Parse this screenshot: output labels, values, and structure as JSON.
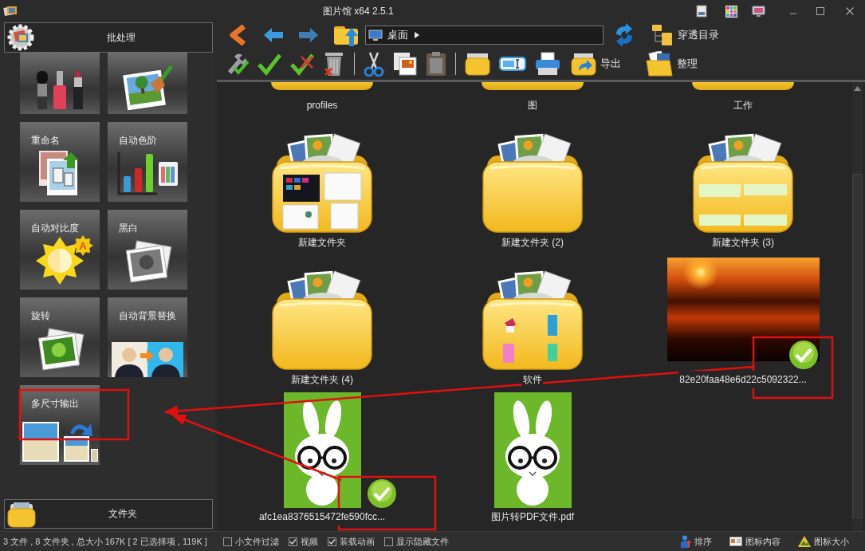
{
  "window": {
    "title": "图片馆 x64 2.5.1"
  },
  "sidebar": {
    "batch_button": "批处理",
    "tools": [
      {
        "kind": "beauty",
        "clipped": true
      },
      {
        "kind": "optimize",
        "clipped": true
      },
      {
        "kind": "rename",
        "label": "重命名",
        "clipped": false
      },
      {
        "kind": "levels",
        "label": "自动色阶",
        "clipped": false
      },
      {
        "kind": "contrast",
        "label": "自动对比度",
        "badge": "A",
        "clipped": false
      },
      {
        "kind": "bw",
        "label": "黑白",
        "clipped": false
      },
      {
        "kind": "rotate",
        "label": "旋转",
        "clipped": false
      },
      {
        "kind": "background",
        "label": "自动背景替换",
        "clipped": false
      },
      {
        "kind": "multisize",
        "label": "多尺寸输出",
        "clipped": false
      }
    ],
    "folder_button": "文件夹"
  },
  "toolbar": {
    "address": "桌面",
    "tree_button": "穿透目录",
    "export_button": "导出",
    "organize_button": "整理"
  },
  "files": [
    {
      "kind": "folder",
      "name": "profiles",
      "clipped": true,
      "selected": false
    },
    {
      "kind": "folder",
      "name": "图",
      "clipped": true,
      "selected": false
    },
    {
      "kind": "folder",
      "name": "工作",
      "clipped": true,
      "selected": false
    },
    {
      "kind": "folder",
      "name": "新建文件夹",
      "preview": {
        "kind": "screens"
      },
      "clipped": false,
      "selected": false
    },
    {
      "kind": "folder",
      "name": "新建文件夹 (2)",
      "clipped": false,
      "selected": false
    },
    {
      "kind": "folder",
      "name": "新建文件夹 (3)",
      "preview": {
        "kind": "tickets"
      },
      "clipped": false,
      "selected": false
    },
    {
      "kind": "folder",
      "name": "新建文件夹 (4)",
      "clipped": false,
      "selected": false
    },
    {
      "kind": "folder",
      "name": "软件",
      "preview": {
        "kind": "apps"
      },
      "clipped": false,
      "selected": false
    },
    {
      "kind": "photo",
      "name": "82e20faa48e6d22c5092322...",
      "clipped": false,
      "selected": true
    },
    {
      "kind": "illustration",
      "name": "afc1ea8376515472fe590fcc...",
      "clipped": false,
      "selected": true
    },
    {
      "kind": "illustration",
      "name": "图片转PDF文件.pdf",
      "clipped": false,
      "selected": false
    }
  ],
  "status_bar": {
    "summary": "3 文件 , 8 文件夹 , 总大小 167K [ 2 已选择项 , 119K ]",
    "options": [
      {
        "label": "小文件过滤",
        "checked": false
      },
      {
        "label": "视频",
        "checked": true
      },
      {
        "label": "装载动画",
        "checked": true
      },
      {
        "label": "显示隐藏文件",
        "checked": false
      }
    ],
    "buttons": [
      {
        "kind": "sort",
        "label": "排序"
      },
      {
        "kind": "content",
        "label": "图标内容"
      },
      {
        "kind": "size",
        "label": "图标大小"
      }
    ]
  }
}
